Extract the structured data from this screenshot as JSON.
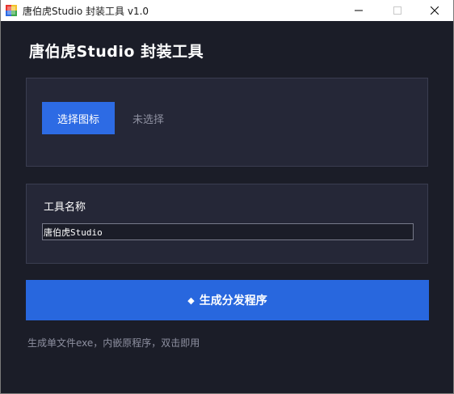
{
  "window": {
    "title": "唐伯虎Studio 封装工具 v1.0"
  },
  "header": {
    "title": "唐伯虎Studio 封装工具"
  },
  "icon_panel": {
    "choose_label": "选择图标",
    "status": "未选择"
  },
  "name_panel": {
    "label": "工具名称",
    "value": "唐伯虎Studio"
  },
  "generate": {
    "icon": "◆",
    "label": "生成分发程序"
  },
  "footer": {
    "note": "生成单文件exe，内嵌原程序，双击即用"
  },
  "colors": {
    "background": "#1b1d28",
    "panel": "#252737",
    "accent": "#2d6be4",
    "muted_text": "#8e90a0"
  }
}
